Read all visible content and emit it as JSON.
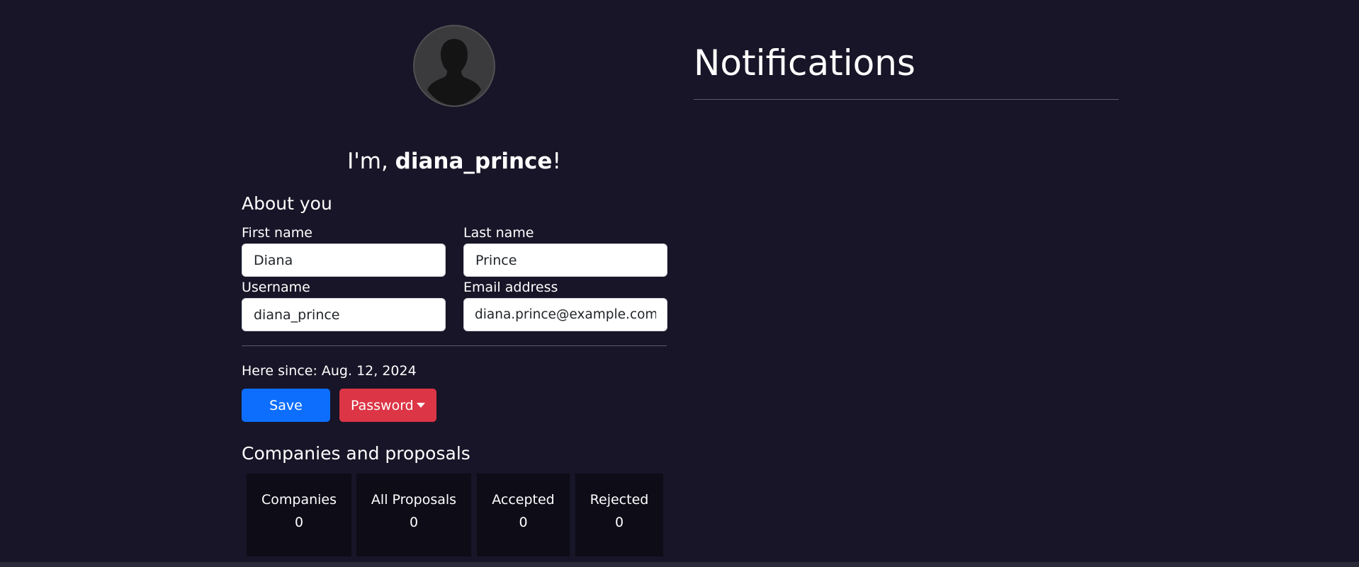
{
  "profile": {
    "avatar_icon": "user-silhouette-icon",
    "greeting_prefix": "I'm, ",
    "username": "diana_prince",
    "greeting_suffix": "!"
  },
  "about": {
    "title": "About you",
    "first_name": {
      "label": "First name",
      "value": "Diana"
    },
    "last_name": {
      "label": "Last name",
      "value": "Prince"
    },
    "username": {
      "label": "Username",
      "value": "diana_prince"
    },
    "email": {
      "label": "Email address",
      "value": "diana.prince@example.com"
    },
    "since": "Here since: Aug. 12, 2024"
  },
  "actions": {
    "save_label": "Save",
    "password_label": "Password"
  },
  "stats": {
    "title": "Companies and proposals",
    "cards": [
      {
        "label": "Companies",
        "value": "0"
      },
      {
        "label": "All Proposals",
        "value": "0"
      },
      {
        "label": "Accepted",
        "value": "0"
      },
      {
        "label": "Rejected",
        "value": "0"
      }
    ]
  },
  "notifications": {
    "title": "Notifications"
  },
  "colors": {
    "background": "#171527",
    "primary": "#0d6efd",
    "danger": "#dc3545",
    "card": "#0d0c17"
  }
}
